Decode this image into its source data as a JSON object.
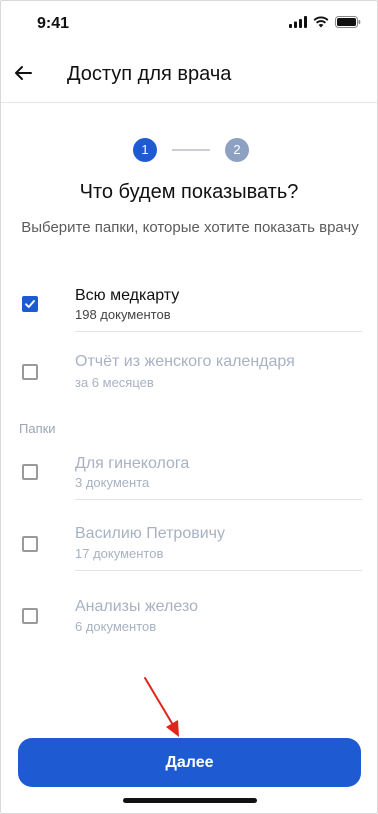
{
  "status_bar": {
    "time": "9:41",
    "icons": [
      "signal-icon",
      "wifi-icon",
      "battery-icon"
    ]
  },
  "header": {
    "back_icon": "arrow-left-icon",
    "title": "Доступ для врача"
  },
  "stepper": {
    "steps": [
      "1",
      "2"
    ],
    "current": 1
  },
  "main": {
    "title": "Что будем показывать?",
    "subtitle": "Выберите папки, которые хотите показать врачу"
  },
  "options": [
    {
      "title": "Всю медкарту",
      "subtitle": "198 документов",
      "checked": true
    },
    {
      "title": "Отчёт из женского календаря",
      "subtitle": "за 6 месяцев",
      "checked": false
    }
  ],
  "folders_section": {
    "label": "Папки",
    "items": [
      {
        "title": "Для гинеколога",
        "subtitle": "3 документа",
        "checked": false
      },
      {
        "title": "Василию Петровичу",
        "subtitle": "17 документов",
        "checked": false
      },
      {
        "title": "Анализы железо",
        "subtitle": "6 документов",
        "checked": false
      }
    ]
  },
  "footer": {
    "next_label": "Далее"
  },
  "colors": {
    "accent": "#1e5bd2",
    "inactive_text": "#a7b2c2",
    "annotation_arrow": "#e0261c"
  }
}
